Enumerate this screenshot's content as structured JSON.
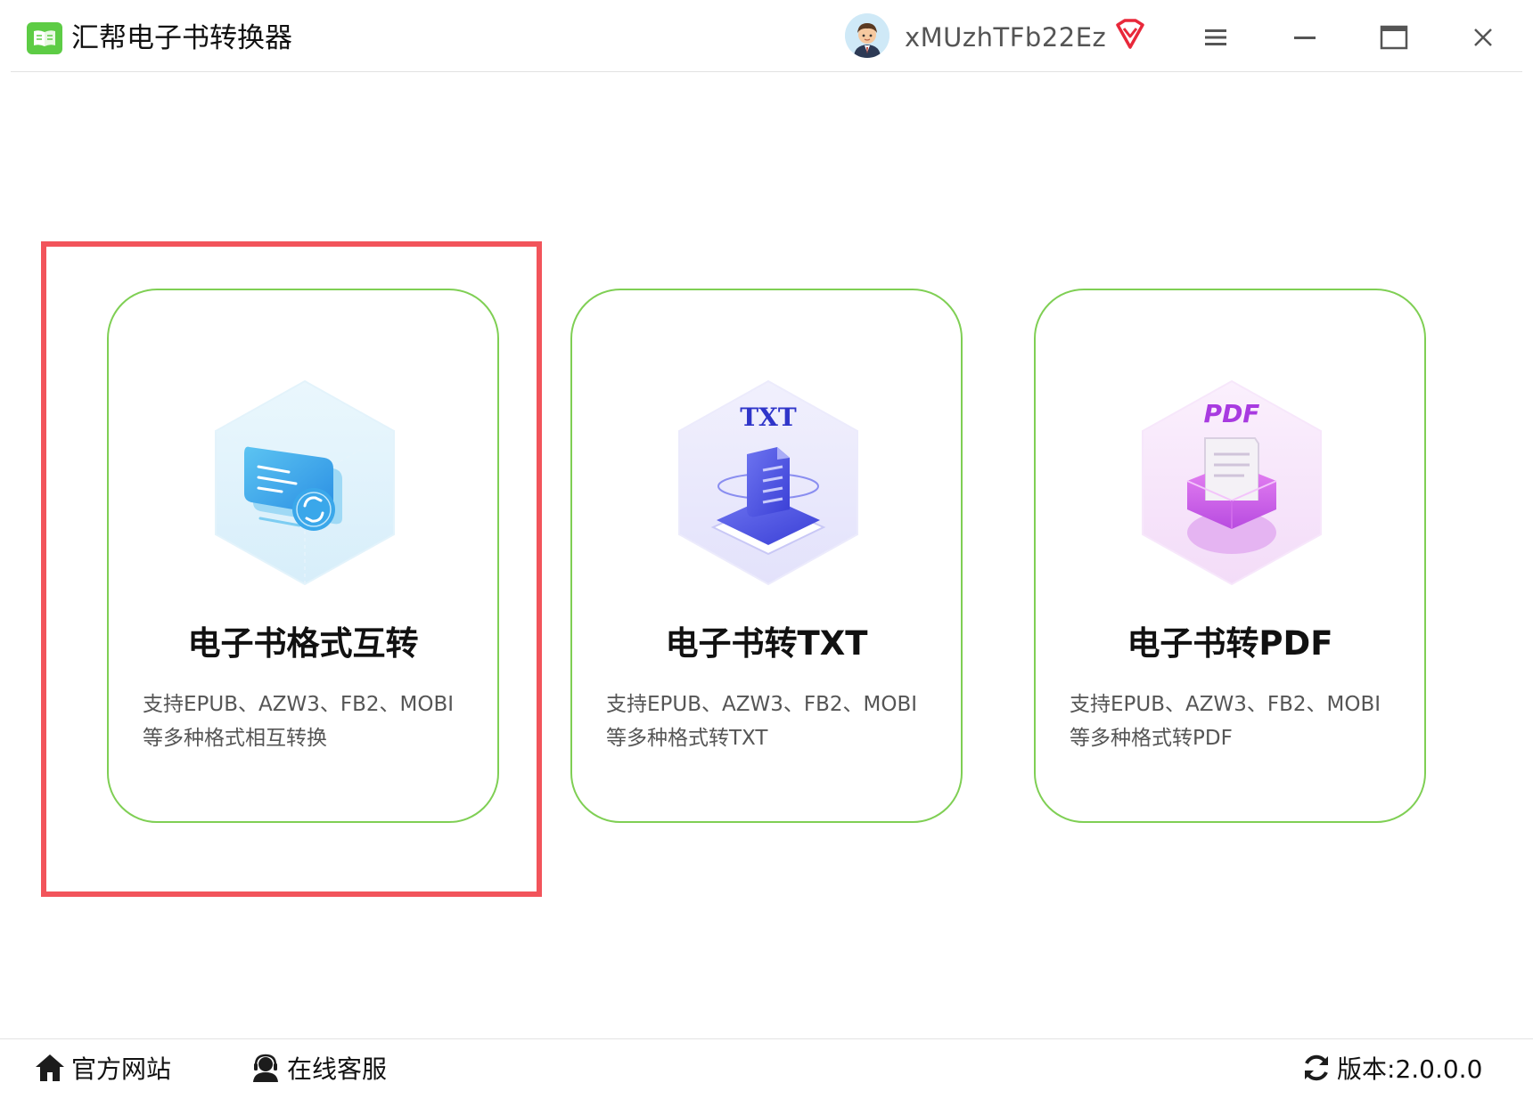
{
  "app": {
    "title": "汇帮电子书转换器",
    "accent_color": "#5dcc45"
  },
  "header": {
    "username": "xMUzhTFb22Ez",
    "icons": [
      "avatar",
      "vip-diamond-icon",
      "menu-icon",
      "minimize-icon",
      "maximize-icon",
      "close-icon"
    ]
  },
  "cards": [
    {
      "title": "电子书格式互转",
      "desc_line1": "支持EPUB、AZW3、FB2、MOBI",
      "desc_line2": "等多种格式相互转换",
      "icon": "ebook-convert-icon",
      "selected": true
    },
    {
      "title": "电子书转TXT",
      "desc_line1": "支持EPUB、AZW3、FB2、MOBI",
      "desc_line2": "等多种格式转TXT",
      "icon": "txt-icon",
      "icon_label": "TXT"
    },
    {
      "title": "电子书转PDF",
      "desc_line1": "支持EPUB、AZW3、FB2、MOBI",
      "desc_line2": "等多种格式转PDF",
      "icon": "pdf-icon",
      "icon_label": "PDF"
    }
  ],
  "colors": {
    "card_border": "#7fcf54",
    "highlight": "#f2545b"
  },
  "footer": {
    "official_site": "官方网站",
    "customer_service": "在线客服",
    "version_label": "版本:",
    "version_value": "2.0.0.0"
  }
}
